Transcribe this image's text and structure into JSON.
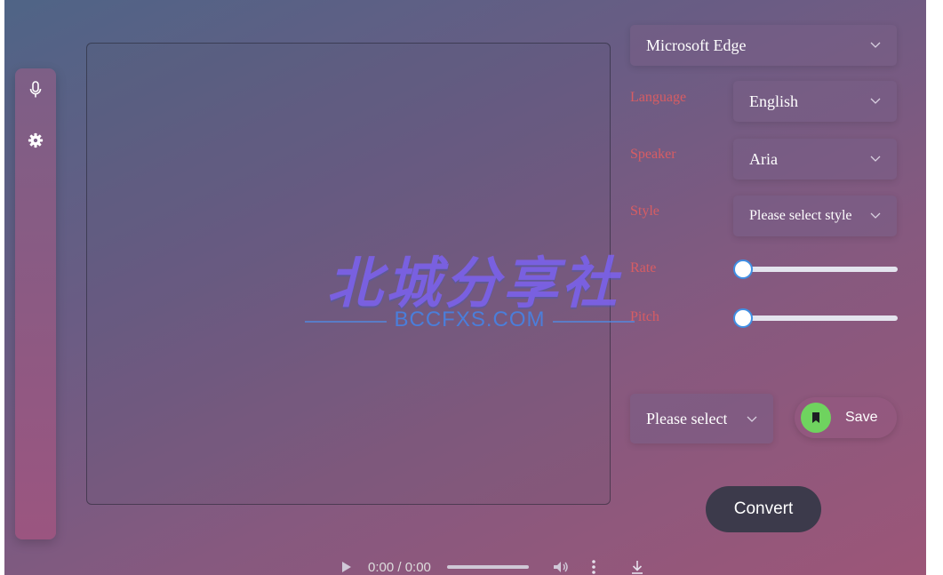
{
  "sidebar": {
    "items": [
      {
        "icon": "microphone-icon"
      },
      {
        "icon": "gear-icon"
      }
    ]
  },
  "editor": {
    "text": "",
    "placeholder": ""
  },
  "browser_select": {
    "value": "Microsoft Edge"
  },
  "fields": {
    "language": {
      "label": "Language",
      "value": "English"
    },
    "speaker": {
      "label": "Speaker",
      "value": "Aria"
    },
    "style": {
      "label": "Style",
      "value": "Please select style"
    },
    "rate": {
      "label": "Rate",
      "value": 0
    },
    "pitch": {
      "label": "Pitch",
      "value": 0
    }
  },
  "format_select": {
    "value": "Please select"
  },
  "save": {
    "label": "Save",
    "icon": "bookmark-icon"
  },
  "convert": {
    "label": "Convert"
  },
  "player": {
    "time": "0:00 / 0:00",
    "progress": 0
  },
  "watermark": {
    "title": "北城分享社",
    "subtitle": "BCCFXS.COM"
  },
  "colors": {
    "label_red": "#d85d63",
    "slider_blue": "#3f8fe4",
    "save_green": "#6fd35f",
    "convert_bg": "#3c3a4b"
  }
}
